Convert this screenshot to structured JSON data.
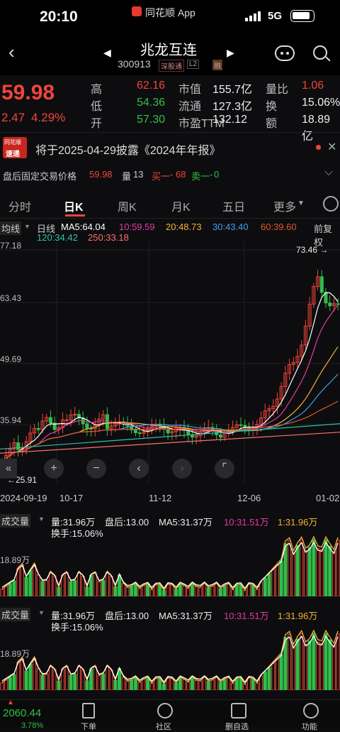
{
  "status": {
    "time": "20:10",
    "app": "同花顺 App",
    "network": "5G"
  },
  "header": {
    "name": "兆龙互连",
    "code": "300913",
    "tag1": "深股通",
    "tag2": "L2",
    "tag3": "融"
  },
  "quote": {
    "price": "59.98",
    "change": "2.47",
    "pct": "4.29%",
    "rows": [
      [
        {
          "k": "高",
          "v": "62.16",
          "c": "red"
        },
        {
          "k": "市值",
          "v": "155.7亿",
          "c": "white"
        },
        {
          "k": "量比",
          "v": "1.06",
          "c": "red"
        }
      ],
      [
        {
          "k": "低",
          "v": "54.36",
          "c": "green"
        },
        {
          "k": "流通",
          "v": "127.3亿",
          "c": "white"
        },
        {
          "k": "换",
          "v": "15.06%",
          "c": "white"
        }
      ],
      [
        {
          "k": "开",
          "v": "57.30",
          "c": "green"
        },
        {
          "k": "市盈TTM",
          "v": "132.12",
          "c": "white"
        },
        {
          "k": "额",
          "v": "18.89亿",
          "c": "white"
        }
      ]
    ]
  },
  "news": {
    "logo1": "同花顺",
    "logo2": "速递",
    "text": "将于2025-04-29披露《2024年年报》"
  },
  "afterhours": {
    "label": "盘后固定交易价格",
    "price": "59.98",
    "vol_label": "量",
    "vol": "13",
    "buy_label": "买一",
    "buy": "68",
    "sell_label": "卖一",
    "sell": "0"
  },
  "tabs": [
    "分时",
    "日K",
    "周K",
    "月K",
    "五日",
    "更多"
  ],
  "ma": {
    "mode": "均线",
    "line": "日线",
    "ma5": "MA5:64.04",
    "ma10": "10:59.59",
    "ma20": "20:48.73",
    "ma30": "30:43.40",
    "ma60": "60:39.60",
    "ma120": "120:34.42",
    "ma250": "250:33.18",
    "adj": "前复权"
  },
  "yticks": [
    "77.18",
    "63.43",
    "49.69",
    "35.94"
  ],
  "low_label": "25.91",
  "high_label": "73.46",
  "xticks": [
    "2024-09-19",
    "10-17",
    "11-12",
    "12-06",
    "01-02"
  ],
  "vol": {
    "label": "成交量",
    "v": "量:31.96万",
    "after": "盘后:13.00",
    "ma5": "MA5:31.37万",
    "ma10": "10:31.51万",
    "ma1": "1:31.96万",
    "turn": "换手:15.06%",
    "ytick": "18.89万"
  },
  "bottom": {
    "index": "2060.44",
    "index_pct": "3.78%",
    "items": [
      "下单",
      "社区",
      "删自选",
      "功能"
    ]
  },
  "colors": {
    "up": "#f0453a",
    "down": "#2fbf4a",
    "ma5": "#ffffff",
    "ma10": "#e63aa5",
    "ma20": "#f2b134",
    "ma30": "#3fa0ef",
    "ma60": "#e8532c",
    "ma120": "#2fc1a5",
    "ma250": "#ff6f6f"
  }
}
